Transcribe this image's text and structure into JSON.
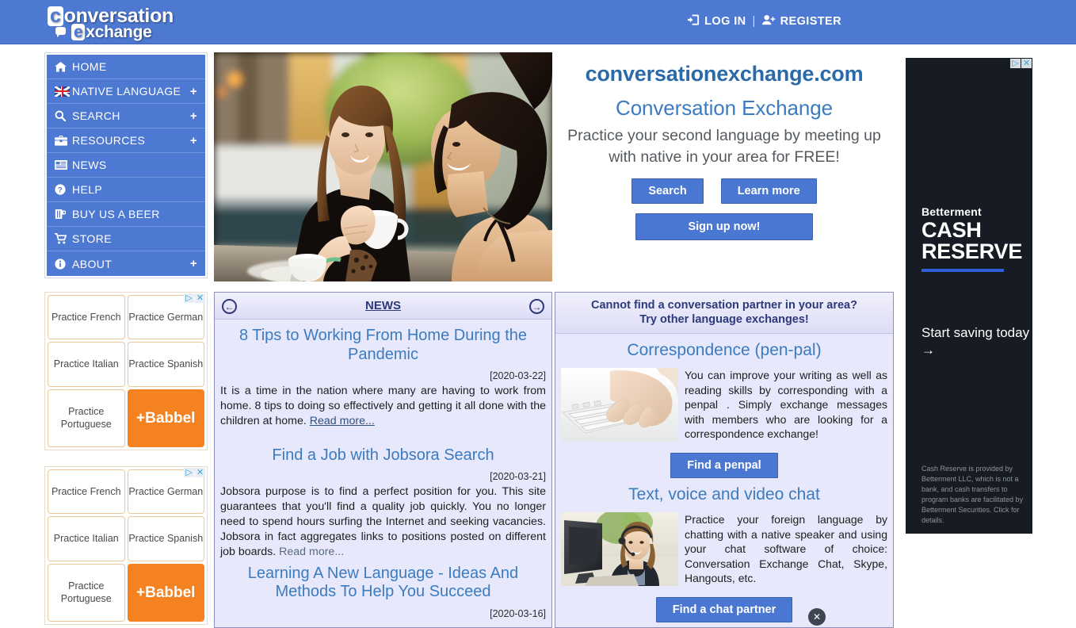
{
  "colors": {
    "header_blue": "#4e79d2",
    "button_blue": "#4a77d1",
    "panel_bg": "#e7e8fb",
    "panel_border": "#8b8fb8",
    "link_blue": "#3b7bbf",
    "heading_navy": "#2b3a7a",
    "babbel_orange": "#f58220",
    "ad_dark": "#171b23"
  },
  "header": {
    "logo_line1": "onversation",
    "logo_line2": "xchange",
    "logo_badge1": "c",
    "logo_badge2": "e",
    "login_label": "LOG IN",
    "login_icon": "login-arrow-icon",
    "separator": "|",
    "register_label": "REGISTER",
    "register_icon": "user-plus-icon"
  },
  "sidebar": {
    "items": [
      {
        "label": "HOME",
        "icon": "home-icon",
        "plus": ""
      },
      {
        "label": "NATIVE LANGUAGE",
        "icon": "uk-flag-icon",
        "plus": "+"
      },
      {
        "label": "SEARCH",
        "icon": "magnifier-icon",
        "plus": "+"
      },
      {
        "label": "RESOURCES",
        "icon": "toolbox-icon",
        "plus": "+"
      },
      {
        "label": "NEWS",
        "icon": "newspaper-icon",
        "plus": ""
      },
      {
        "label": "HELP",
        "icon": "question-circle-icon",
        "plus": ""
      },
      {
        "label": "BUY US A BEER",
        "icon": "beer-mug-icon",
        "plus": ""
      },
      {
        "label": "STORE",
        "icon": "shopping-cart-icon",
        "plus": ""
      },
      {
        "label": "ABOUT",
        "icon": "info-circle-icon",
        "plus": "+"
      }
    ]
  },
  "hero": {
    "photo_alt": "two-women-chatting-over-coffee-photo",
    "domain": "conversationexchange.com",
    "title": "Conversation Exchange",
    "subtitle": "Practice your second language by meeting up with native in your area for FREE!",
    "search_button": "Search",
    "learn_more_button": "Learn more",
    "signup_button": "Sign up now!"
  },
  "ads": {
    "left_blocks": [
      {
        "choices_icon": "adchoices-icon",
        "close_icon": "close-icon",
        "cells": [
          {
            "text": "Practice French",
            "brand": false
          },
          {
            "text": "Practice German",
            "brand": false
          },
          {
            "text": "Practice Italian",
            "brand": false
          },
          {
            "text": "Practice Spanish",
            "brand": false
          },
          {
            "text": "Practice Portuguese",
            "brand": false
          },
          {
            "text": "+Babbel",
            "brand": true
          }
        ]
      },
      {
        "choices_icon": "adchoices-icon",
        "close_icon": "close-icon",
        "cells": [
          {
            "text": "Practice French",
            "brand": false
          },
          {
            "text": "Practice German",
            "brand": false
          },
          {
            "text": "Practice Italian",
            "brand": false
          },
          {
            "text": "Practice Spanish",
            "brand": false
          },
          {
            "text": "Practice Portuguese",
            "brand": false
          },
          {
            "text": "+Babbel",
            "brand": true
          }
        ]
      }
    ],
    "skyscraper": {
      "choices_icon": "adchoices-icon",
      "close_icon": "close-icon",
      "brand": "Betterment",
      "headline_line1": "CASH",
      "headline_line2": "RESERVE",
      "cta": "Start saving today →",
      "legal": "Cash Reserve is provided by Betterment LLC, which is not a bank, and cash transfers to program banks are facilitated by Betterment Securities. Click for details."
    }
  },
  "news_panel": {
    "header_title": "NEWS",
    "prev_icon": "arrow-left-circle-icon",
    "next_icon": "arrow-right-circle-icon",
    "articles": [
      {
        "title": "8 Tips to Working From Home During the Pandemic",
        "date": "[2020-03-22]",
        "body": "It is a time in the nation where many are having to work from home. 8 tips to doing so effectively and getting it all done with the children at home. ",
        "read_more": "Read more..."
      },
      {
        "title": "Find a Job with Jobsora Search",
        "date": "[2020-03-21]",
        "body": "Jobsora purpose is to find a perfect position for you. This site guarantees that you'll find a quality job quickly. You no longer need to spend hours surfing the Internet and seeking vacancies. Jobsora in fact aggregates links to positions posted on different job boards. ",
        "read_more": "Read more..."
      },
      {
        "title": "Learning A New Language - Ideas And Methods To Help You Succeed",
        "date": "[2020-03-16]",
        "body": "",
        "read_more": ""
      }
    ]
  },
  "other_panel": {
    "header_title": "Cannot find a conversation partner in your area? Try other language exchanges!",
    "sections": [
      {
        "title": "Correspondence (pen-pal)",
        "thumb": "hands-typing-on-keyboard-photo",
        "text": "You can improve your writing as well as reading skills by corresponding with a penpal . Simply exchange messages with members who are looking for a correspondence exchange!",
        "button": "Find a penpal"
      },
      {
        "title": "Text, voice and video chat",
        "thumb": "woman-with-headset-at-computer-photo",
        "text": "Practice your foreign language by chatting with a native speaker and using your chat software of choice: Conversation Exchange Chat, Skype, Hangouts, etc.",
        "button": "Find a chat partner"
      }
    ],
    "close_icon": "close-circle-icon",
    "close_glyph": "✕"
  }
}
